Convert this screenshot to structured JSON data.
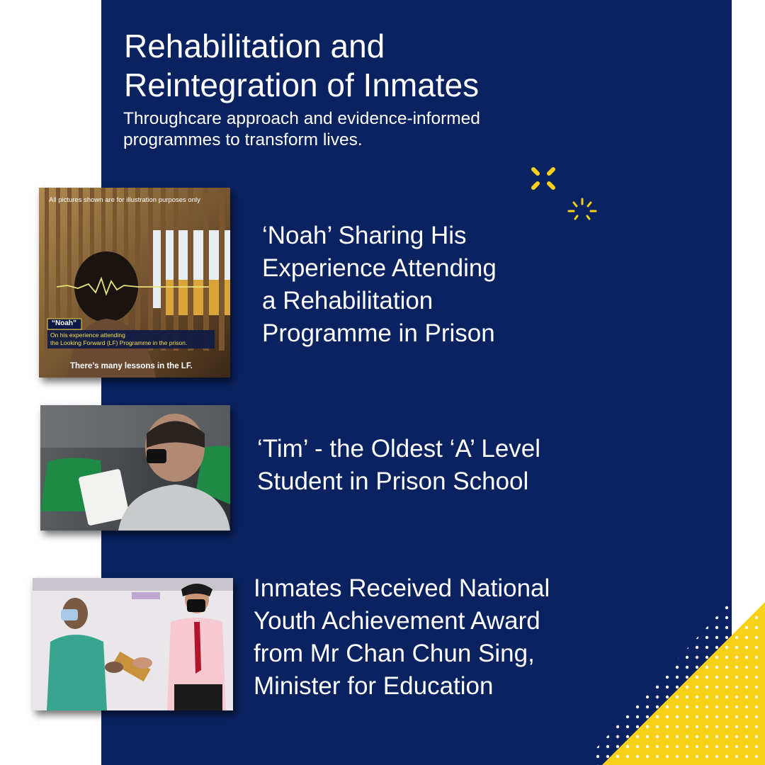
{
  "colors": {
    "panel": "#0b2260",
    "accent": "#f7d117",
    "text": "#ffffff"
  },
  "header": {
    "title_lines": [
      "Rehabilitation and",
      "Reintegration of Inmates"
    ],
    "subtitle_lines": [
      "Throughcare approach and evidence-informed",
      "programmes to transform lives."
    ]
  },
  "cards": [
    {
      "title_lines": [
        "‘Noah’ Sharing His",
        "Experience Attending",
        "a Rehabilitation",
        "Programme in Prison"
      ],
      "thumb": {
        "disclaimer": "All pictures shown are for illustration purposes only",
        "name_tag": "“Noah”",
        "caption_line1": "On his experience attending",
        "caption_line2": "the Looking Forward (LF) Programme in the prison.",
        "subtitle": "There’s many lessons in the LF."
      }
    },
    {
      "title_lines": [
        "‘Tim’ - the Oldest ‘A’ Level",
        "Student in Prison School"
      ]
    },
    {
      "title_lines": [
        "Inmates Received National",
        "Youth Achievement Award",
        "from Mr Chan Chun Sing,",
        "Minister for Education"
      ]
    }
  ],
  "icons": [
    "sparkle-icon",
    "sparkle-icon",
    "dotted-triangle-decoration",
    "yellow-triangle-decoration"
  ]
}
